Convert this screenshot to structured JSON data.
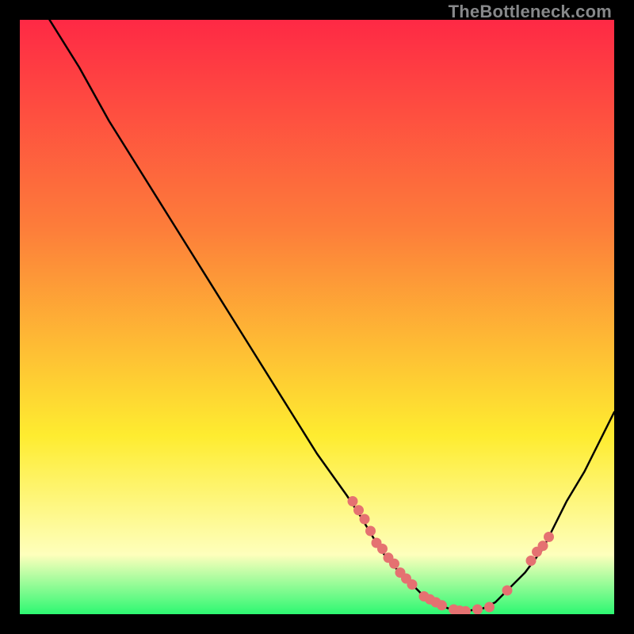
{
  "watermark": "TheBottleneck.com",
  "colors": {
    "gradient_top": "#fe2945",
    "gradient_mid1": "#fd7d3a",
    "gradient_mid2": "#feec30",
    "gradient_pale": "#feffbc",
    "gradient_green": "#2df872",
    "curve": "#000000",
    "dot": "#e57171",
    "background": "#000000"
  },
  "chart_data": {
    "type": "line",
    "title": "",
    "xlabel": "",
    "ylabel": "",
    "xlim": [
      0,
      100
    ],
    "ylim": [
      0,
      100
    ],
    "curve": {
      "x": [
        5,
        10,
        15,
        20,
        25,
        30,
        35,
        40,
        45,
        50,
        55,
        57,
        60,
        62,
        65,
        68,
        70,
        72,
        75,
        78,
        80,
        82,
        85,
        88,
        90,
        92,
        95,
        100
      ],
      "y": [
        100,
        92,
        83,
        75,
        67,
        59,
        51,
        43,
        35,
        27,
        20,
        17,
        12,
        9,
        6,
        3,
        2,
        1,
        0.5,
        1,
        2,
        4,
        7,
        11,
        15,
        19,
        24,
        34
      ]
    },
    "dots": {
      "x": [
        56,
        57,
        58,
        59,
        60,
        61,
        62,
        63,
        64,
        65,
        66,
        68,
        69,
        70,
        71,
        73,
        74,
        75,
        77,
        79,
        82,
        86,
        87,
        88,
        89
      ],
      "y": [
        19,
        17.5,
        16,
        14,
        12,
        11,
        9.5,
        8.5,
        7,
        6,
        5,
        3,
        2.5,
        2,
        1.5,
        0.8,
        0.6,
        0.5,
        0.8,
        1.2,
        4,
        9,
        10.5,
        11.5,
        13
      ]
    }
  }
}
